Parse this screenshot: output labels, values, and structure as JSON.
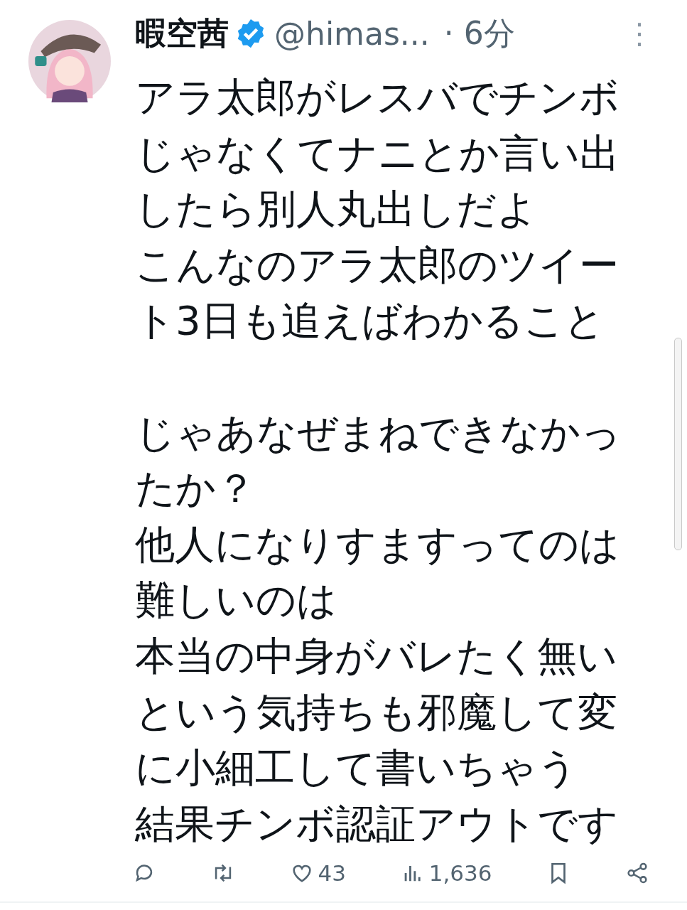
{
  "post": {
    "author": {
      "name": "暇空茜",
      "verified": true,
      "handle": "@himas...",
      "time": "· 6分"
    },
    "menu": "⋮",
    "paragraphs": [
      [
        "アラ太郎がレスバでチンボじゃなくてナニとか言い出したら別人丸出しだよ",
        "こんなのアラ太郎のツイート3日も追えばわかること"
      ],
      [
        "じゃあなぜまねできなかったか？",
        "他人になりすますってのは難しいのは",
        "本当の中身がバレたく無いという気持ちも邪魔して変に小細工して書いちゃう",
        "結果チンボ認証アウトです"
      ]
    ],
    "actions": [
      {
        "kind": "reply"
      },
      {
        "kind": "repost"
      },
      {
        "kind": "like",
        "count": "43"
      },
      {
        "kind": "views",
        "count": "1,636"
      },
      {
        "kind": "bookmark"
      },
      {
        "kind": "share"
      }
    ]
  }
}
